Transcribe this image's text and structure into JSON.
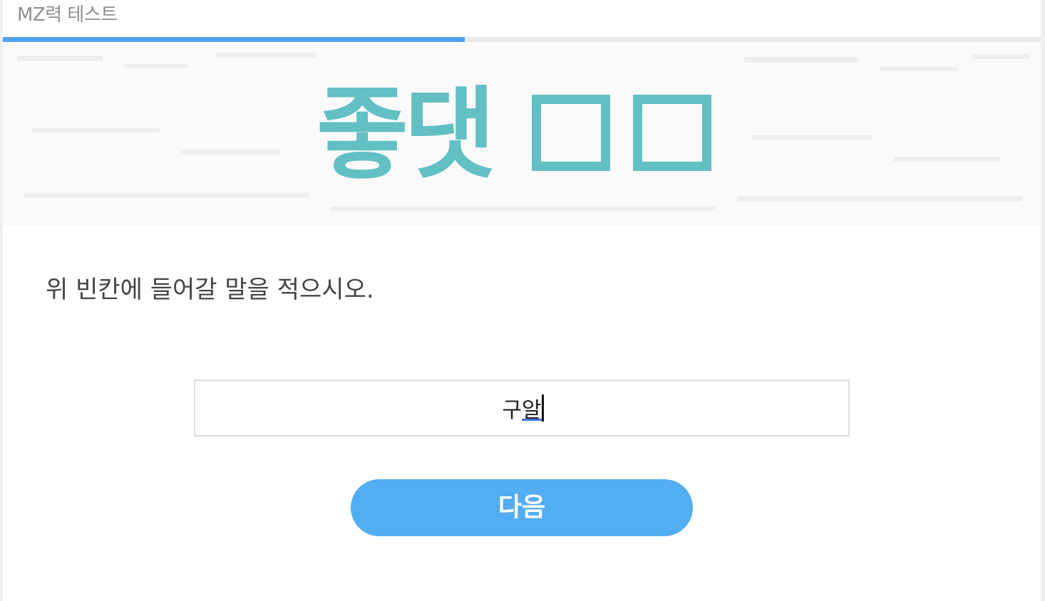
{
  "header": {
    "title": "MZ력 테스트"
  },
  "progress": {
    "fraction": 0.445,
    "color": "#4ea5ee",
    "track_color": "#e9e9e9"
  },
  "quiz": {
    "word_text": "좋댓",
    "blank_count": 2,
    "word_color": "#62bfc4",
    "question": "위 빈칸에 들어갈 말을 적으시오.",
    "answer_value": "구알"
  },
  "actions": {
    "next_label": "다음",
    "next_color": "#52adf3"
  }
}
